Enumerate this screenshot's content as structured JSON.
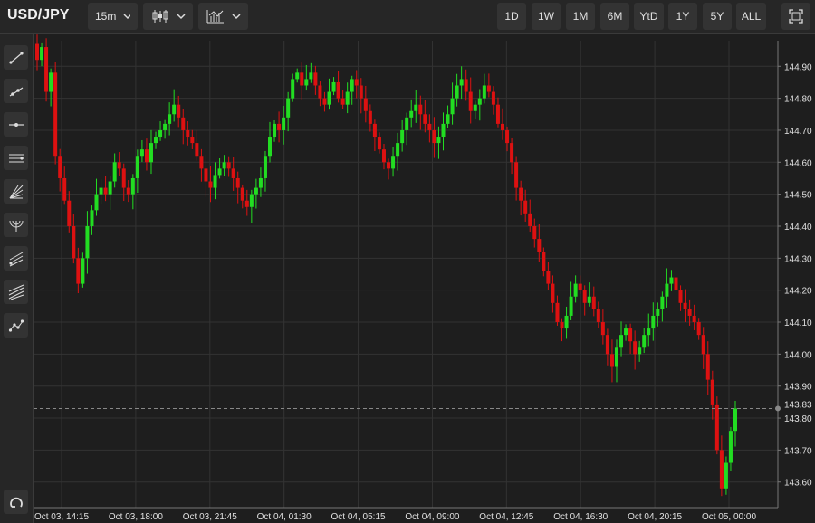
{
  "symbol": "USD/JPY",
  "toolbar": {
    "interval_label": "15m",
    "chart_type_icon": "candlestick-icon",
    "indicators_icon": "indicators-icon",
    "ranges": [
      "1D",
      "1W",
      "1M",
      "6M",
      "YtD",
      "1Y",
      "5Y",
      "ALL"
    ],
    "fullscreen_icon": "fullscreen-icon"
  },
  "drawing_tools": [
    "trend-line-icon",
    "ray-icon",
    "horizontal-line-icon",
    "parallel-channel-icon",
    "fan-icon",
    "arc-icon",
    "pitchfork-icon",
    "fibonacci-icon",
    "polyline-icon"
  ],
  "bottom_tool": "magnet-icon",
  "colors": {
    "background": "#1e1e1e",
    "grid": "#333333",
    "up": "#22dd22",
    "down": "#dd1111",
    "axis": "#777777",
    "label": "#e0e0e0",
    "crosshair": "#888888"
  },
  "chart_data": {
    "type": "candlestick",
    "interval": "15m",
    "ylim": [
      143.52,
      144.98
    ],
    "y_ticks": [
      143.6,
      143.7,
      143.8,
      143.9,
      144.0,
      144.1,
      144.2,
      144.3,
      144.4,
      144.5,
      144.6,
      144.7,
      144.8,
      144.9
    ],
    "y_tick_labels": [
      "143.60",
      "143.70",
      "143.80",
      "143.90",
      "144.00",
      "144.10",
      "144.20",
      "144.30",
      "144.40",
      "144.50",
      "144.60",
      "144.70",
      "144.80",
      "144.90"
    ],
    "x_tick_labels": [
      "Oct 03, 14:15",
      "Oct 03, 18:00",
      "Oct 03, 21:45",
      "Oct 04, 01:30",
      "Oct 04, 05:15",
      "Oct 04, 09:00",
      "Oct 04, 12:45",
      "Oct 04, 16:30",
      "Oct 04, 20:15",
      "Oct 05, 00:00"
    ],
    "current_price": 143.83,
    "current_price_label": "143.83",
    "grid": true,
    "ohlc_path": [
      144.92,
      144.96,
      144.82,
      144.88,
      144.62,
      144.55,
      144.48,
      144.4,
      144.3,
      144.22,
      144.3,
      144.4,
      144.45,
      144.5,
      144.52,
      144.5,
      144.54,
      144.6,
      144.58,
      144.52,
      144.5,
      144.55,
      144.62,
      144.64,
      144.6,
      144.66,
      144.68,
      144.7,
      144.72,
      144.75,
      144.78,
      144.74,
      144.7,
      144.68,
      144.66,
      144.62,
      144.58,
      144.54,
      144.52,
      144.56,
      144.58,
      144.6,
      144.58,
      144.55,
      144.52,
      144.48,
      144.46,
      144.5,
      144.52,
      144.55,
      144.62,
      144.68,
      144.72,
      144.7,
      144.74,
      144.8,
      144.86,
      144.88,
      144.84,
      144.86,
      144.88,
      144.84,
      144.8,
      144.78,
      144.82,
      144.85,
      144.8,
      144.78,
      144.82,
      144.86,
      144.84,
      144.8,
      144.76,
      144.72,
      144.68,
      144.64,
      144.6,
      144.58,
      144.62,
      144.66,
      144.7,
      144.74,
      144.76,
      144.78,
      144.75,
      144.72,
      144.7,
      144.66,
      144.68,
      144.72,
      144.75,
      144.8,
      144.84,
      144.86,
      144.82,
      144.76,
      144.78,
      144.8,
      144.84,
      144.82,
      144.78,
      144.72,
      144.7,
      144.66,
      144.6,
      144.52,
      144.48,
      144.44,
      144.4,
      144.36,
      144.32,
      144.26,
      144.22,
      144.16,
      144.1,
      144.08,
      144.12,
      144.18,
      144.22,
      144.2,
      144.16,
      144.18,
      144.14,
      144.1,
      144.06,
      144.0,
      143.96,
      144.02,
      144.06,
      144.08,
      144.04,
      144.0,
      144.02,
      144.06,
      144.08,
      144.12,
      144.14,
      144.18,
      144.22,
      144.24,
      144.2,
      144.16,
      144.14,
      144.12,
      144.1,
      144.06,
      144.0,
      143.92,
      143.84,
      143.7,
      143.58,
      143.66,
      143.76,
      143.83
    ]
  }
}
